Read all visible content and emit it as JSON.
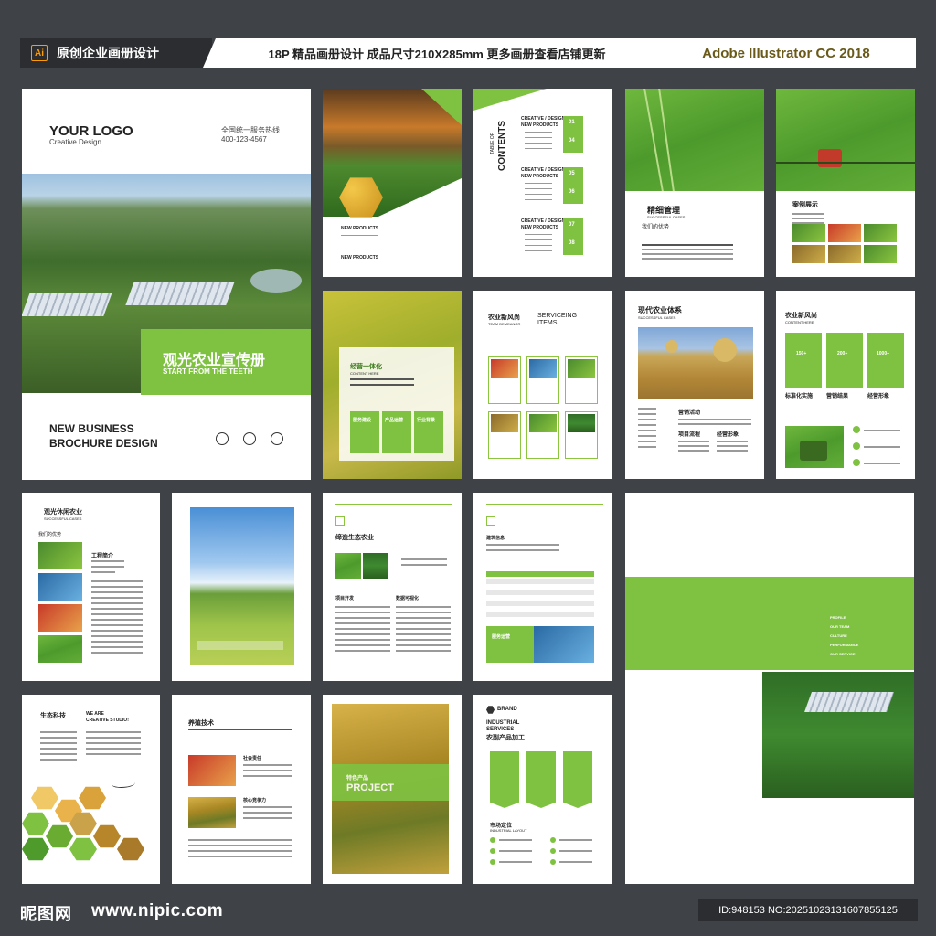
{
  "banner": {
    "ai_badge": "Ai",
    "brand": "原创企业画册设计",
    "spec": "18P 精品画册设计 成品尺寸210X285mm 更多画册查看店铺更新",
    "software": "Adobe Illustrator CC 2018"
  },
  "cover": {
    "logo": "YOUR LOGO",
    "logo_sub": "Creative Design",
    "hotline_label": "全国统一服务热线",
    "phone": "400-123-4567",
    "title_cn": "观光农业宣传册",
    "title_en": "START FROM THE TEETH",
    "bottom_line1": "NEW BUSINESS",
    "bottom_line2": "BROCHURE DESIGN"
  },
  "p2": {
    "label": "NEW PRODUCTS",
    "label2": "NEW PRODUCTS"
  },
  "toc": {
    "heading": "CONTENTS",
    "side": "TABLE OF",
    "blocks": [
      {
        "a": "CREATIVE / DESIGN",
        "b": "NEW PRODUCTS",
        "n1": "01",
        "n2": "04"
      },
      {
        "a": "CREATIVE / DESIGN",
        "b": "NEW PRODUCTS",
        "n1": "05",
        "n2": "06"
      },
      {
        "a": "CREATIVE / DESIGN",
        "b": "NEW PRODUCTS",
        "n1": "07",
        "n2": "08"
      }
    ]
  },
  "p4": {
    "title": "精细管理",
    "sub": "SUCCESSFUL CASES",
    "label": "我们的优势"
  },
  "p5": {
    "title": "案例展示"
  },
  "p6": {
    "title": "经营一体化",
    "sub": "CONTENT HERE",
    "cards": [
      "服务建设",
      "产品运营",
      "行业背景"
    ]
  },
  "p7": {
    "title": "农业新风尚",
    "sub": "TEAM DEMEANOR",
    "title2": "SERVICEING",
    "title3": "ITEMS"
  },
  "p8": {
    "title": "现代农业体系",
    "sub": "SUCCESSFUL CASES",
    "h1": "营销活动",
    "h2": "项目流程",
    "h3": "经营形象"
  },
  "p9": {
    "title": "农业新风尚",
    "sub": "CONTENT HERE",
    "stats": [
      "150+",
      "200+",
      "1000+"
    ],
    "labels": [
      "标准化实施",
      "营销结果",
      "经营形象"
    ]
  },
  "p10": {
    "title": "观光休闲农业",
    "sub": "SUCCESSFUL CASES",
    "label": "我们的优势",
    "h": "工程简介"
  },
  "p12": {
    "title": "缔造生态农业",
    "h1": "项目开发",
    "h2": "数据可视化"
  },
  "p13": {
    "h": "建筑信息",
    "green": "服务运营"
  },
  "spread": {
    "menu": [
      "PROFILE",
      "OUR TEAM",
      "CULTURE",
      "PERFORMANCE",
      "OUR SERVICE"
    ]
  },
  "p15": {
    "title": "生态科技",
    "en1": "WE ARE",
    "en2": "CREATIVE STUDIO!"
  },
  "p16": {
    "title": "养殖技术",
    "h1": "社会责任",
    "h2": "核心竞争力"
  },
  "p17": {
    "cn": "特色产品",
    "en": "PROJECT"
  },
  "p18": {
    "brand": "BRAND",
    "en1": "INDUSTRIAL",
    "en2": "SERVICES",
    "title": "农副产品加工",
    "h": "市场定位",
    "sub": "INDUSTRIAL LAYOUT"
  },
  "footer": {
    "logo": "昵图网",
    "url": "www.nipic.com",
    "id": "ID:948153 NO:20251023131607855125"
  },
  "colors": {
    "accent": "#7fc242",
    "background": "#3f4347"
  }
}
